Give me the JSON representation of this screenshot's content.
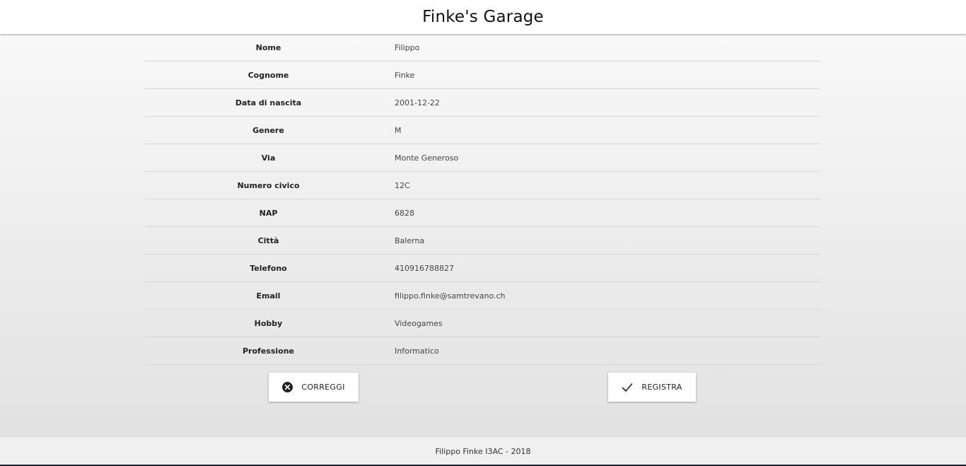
{
  "header": {
    "title": "Finke's Garage"
  },
  "rows": [
    {
      "label": "Nome",
      "value": "Filippo"
    },
    {
      "label": "Cognome",
      "value": "Finke"
    },
    {
      "label": "Data di nascita",
      "value": "2001-12-22"
    },
    {
      "label": "Genere",
      "value": "M"
    },
    {
      "label": "Via",
      "value": "Monte Generoso"
    },
    {
      "label": "Numero civico",
      "value": "12C"
    },
    {
      "label": "NAP",
      "value": "6828"
    },
    {
      "label": "Città",
      "value": "Balerna"
    },
    {
      "label": "Telefono",
      "value": "410916788827"
    },
    {
      "label": "Email",
      "value": "filippo.finke@samtrevano.ch"
    },
    {
      "label": "Hobby",
      "value": "Videogames"
    },
    {
      "label": "Professione",
      "value": "Informatico"
    }
  ],
  "actions": {
    "correggi": {
      "label": "CORREGGI",
      "icon": "cancel-circle-icon"
    },
    "registra": {
      "label": "REGISTRA",
      "icon": "check-icon"
    }
  },
  "footer": {
    "text": "Filippo Finke I3AC - 2018"
  }
}
